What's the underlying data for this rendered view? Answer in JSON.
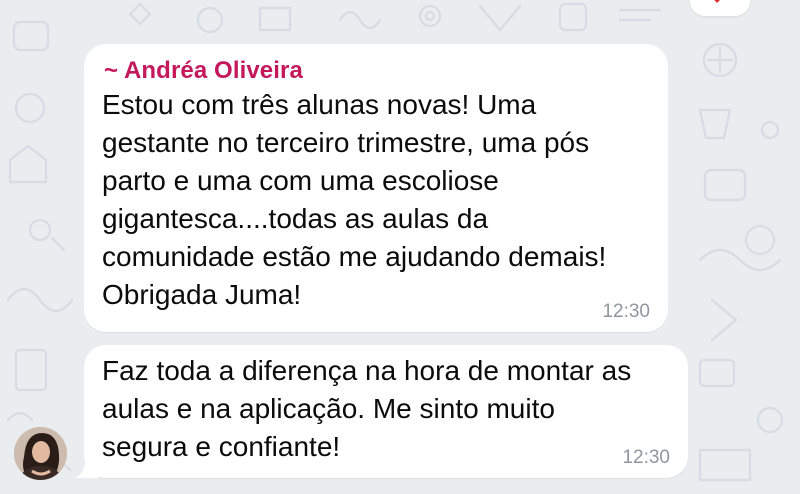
{
  "messages": [
    {
      "sender": "~ Andréa Oliveira",
      "text": "Estou com três alunas novas! Uma\ngestante no terceiro trimestre, uma pós\nparto e uma com uma escoliose\ngigantesca....todas as aulas da\ncomunidade estão me ajudando demais!\nObrigada Juma!",
      "time": "12:30"
    },
    {
      "text": "Faz toda a diferença na hora de montar as\naulas e na aplicação. Me sinto muito\nsegura e confiante!",
      "time": "12:30"
    }
  ],
  "reaction": {
    "emoji": "❤",
    "icon": "heart-icon",
    "color": "#e0252f"
  },
  "colors": {
    "sender_name": "#c4185c",
    "bubble": "#ffffff",
    "background": "#e9edf0",
    "timestamp": "#8e979e"
  }
}
